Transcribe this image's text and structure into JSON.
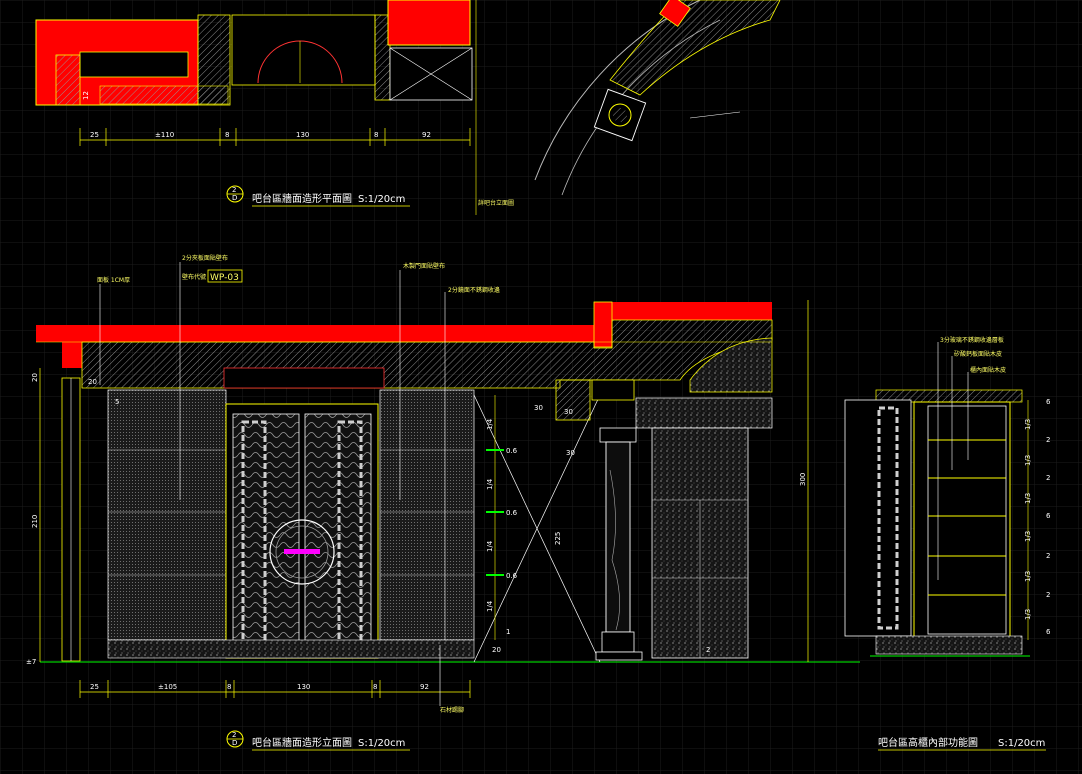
{
  "drawings": {
    "plan": {
      "title": "吧台區牆面造形平面圖",
      "scale": "S:1/20cm",
      "circle_top": "2",
      "circle_bottom": "D",
      "dims": [
        "25",
        "±110",
        "8",
        "130",
        "8",
        "92"
      ],
      "side_dim": "12",
      "note": "詳吧台立面圖"
    },
    "elevation": {
      "title": "吧台區牆面造形立面圖",
      "scale": "S:1/20cm",
      "circle_top": "2",
      "circle_bottom": "D",
      "labels": [
        "面板 1CM厚",
        "2分夾板面貼壁布",
        "壁布代號",
        "木製門面貼壁布",
        "2分鏡面不銹鋼收邊"
      ],
      "code": "WP-03",
      "bottom_dims": [
        "25",
        "±105",
        "8",
        "130",
        "8",
        "92"
      ],
      "top_dims": [
        "20",
        "5",
        "30"
      ],
      "left_dims": [
        "20",
        "210",
        "±7"
      ],
      "right_dims": [
        "300"
      ],
      "mid_dims": [
        "1/4",
        "0.6",
        "1/4",
        "0.6",
        "1/4",
        "0.6",
        "1/4",
        "1"
      ],
      "column_dims": [
        "30",
        "30",
        "225",
        "20",
        "2"
      ],
      "bottom_note": "石材踢腳"
    },
    "cabinet": {
      "title": "吧台區高櫃內部功能圖",
      "scale": "S:1/20cm",
      "labels": [
        "3分玻璃不銹鋼收邊層板",
        "矽酸鈣板面貼木皮",
        "櫃內面貼木皮"
      ],
      "dims": [
        "6",
        "1/3",
        "2",
        "1/3",
        "2",
        "1/3",
        "6",
        "1/3",
        "2",
        "1/3",
        "2",
        "1/3",
        "6"
      ]
    }
  },
  "colors": {
    "background": "#000000",
    "grid": "#1a1a1a",
    "accent_red": "#ff0000",
    "line_yellow": "#ffff00",
    "line_white": "#ffffff",
    "floor_green": "#00cc00",
    "door_magenta": "#ff00ff"
  }
}
